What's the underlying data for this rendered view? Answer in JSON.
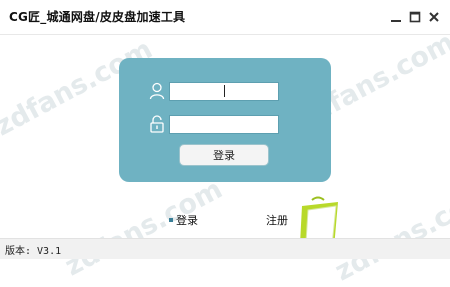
{
  "window": {
    "title": "CG匠_城通网盘/皮皮盘加速工具",
    "controls": [
      "minimize-icon",
      "maximize-icon",
      "close-icon"
    ]
  },
  "watermark": {
    "text": "zdfans.com"
  },
  "login_panel": {
    "username": {
      "value": "",
      "placeholder": ""
    },
    "password": {
      "value": "",
      "placeholder": ""
    },
    "login_button": "登录"
  },
  "bottom_links": {
    "login": "登录",
    "register": "注册"
  },
  "status": {
    "version": "版本: V3.1"
  },
  "colors": {
    "panel": "#6fb2c2",
    "titlebar": "#ffffff",
    "statusbar": "#f1f1f1",
    "accent_green": "#b8d92a"
  }
}
